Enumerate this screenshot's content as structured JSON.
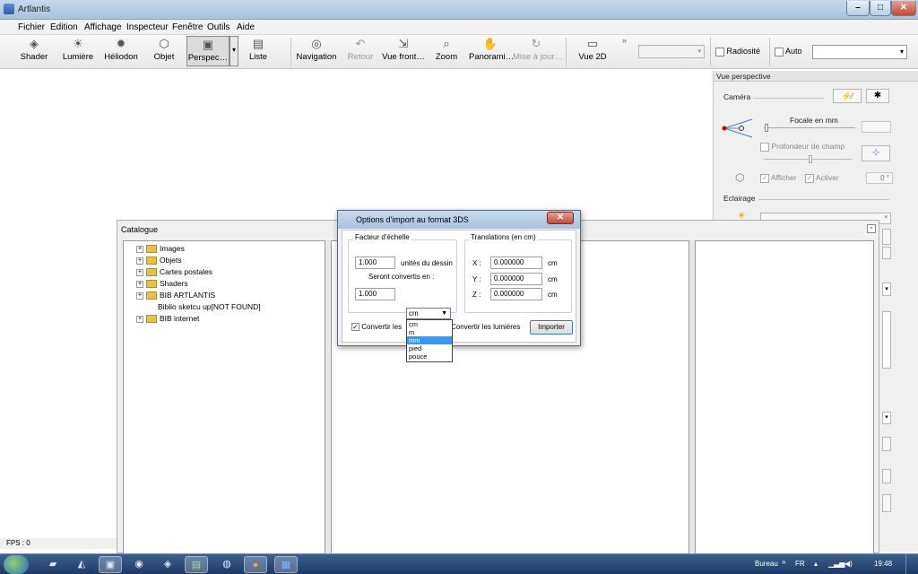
{
  "window": {
    "title": "Artlantis",
    "min": "–",
    "max": "□",
    "close": "✕"
  },
  "menu": [
    "Fichier",
    "Edition",
    "Affichage",
    "Inspecteur",
    "Fenêtre",
    "Outils",
    "Aide"
  ],
  "toolbar": {
    "items": [
      {
        "label": "Shader",
        "icon": "shader-icon",
        "glyph": "◈"
      },
      {
        "label": "Lumière",
        "icon": "light-bulb-icon",
        "glyph": "☀"
      },
      {
        "label": "Héliodon",
        "icon": "sun-icon",
        "glyph": "✹"
      },
      {
        "label": "Objet",
        "icon": "object-cube-icon",
        "glyph": "⬡"
      },
      {
        "label": "Perspec…",
        "icon": "camera-icon",
        "glyph": "▣"
      },
      {
        "label": "Liste",
        "icon": "list-icon",
        "glyph": "▤"
      },
      {
        "label": "Navigation",
        "icon": "navigation-icon",
        "glyph": "◎"
      },
      {
        "label": "Retour",
        "icon": "undo-icon",
        "glyph": "↶"
      },
      {
        "label": "Vue front…",
        "icon": "front-view-icon",
        "glyph": "⇲"
      },
      {
        "label": "Zoom",
        "icon": "zoom-icon",
        "glyph": "⌕"
      },
      {
        "label": "Panorami…",
        "icon": "pan-hand-icon",
        "glyph": "✋"
      },
      {
        "label": "Mise à jour…",
        "icon": "refresh-icon",
        "glyph": "↻"
      },
      {
        "label": "Vue 2D",
        "icon": "view-2d-icon",
        "glyph": "▭"
      }
    ],
    "more": "»",
    "radiosite": "Radiosité",
    "auto": "Auto"
  },
  "status": {
    "fps": "FPS : 0"
  },
  "right_panel": {
    "title": "Vue perspective",
    "camera": "Caméra",
    "focale": "Focale en mm",
    "profondeur": "Profondeur de champ",
    "afficher": "Afficher",
    "activer": "Activer",
    "angle_unit": "0 °",
    "eclairage": "Eclairage"
  },
  "catalog": {
    "title": "Catalogue",
    "tree": [
      "Images",
      "Objets",
      "Cartes postales",
      "Shaders",
      "BIB ARTLANTIS",
      "Biblio sketcu up[NOT FOUND]",
      "BIB internet"
    ]
  },
  "dialog": {
    "title": "Options d'import au format 3DS",
    "close": "✕",
    "scale_legend": "Facteur d'échelle",
    "scale_value": "1.000",
    "scale_unit": "unités du dessin",
    "converted_label": "Seront convertis en :",
    "converted_value": "1.000",
    "unit_selected": "cm",
    "unit_options": [
      "cm",
      "m",
      "mm",
      "pied",
      "pouce"
    ],
    "translations_legend": "Translations (en cm)",
    "x_label": "X :",
    "x_value": "0.000000",
    "y_label": "Y :",
    "y_value": "0.000000",
    "z_label": "Z :",
    "z_value": "0.000000",
    "cm": "cm",
    "convert_les": "Convertir les",
    "convert_lights": "Convertir les lumières",
    "import_button": "Importer"
  },
  "taskbar": {
    "bureau": "Bureau",
    "chev": "»",
    "lang": "FR",
    "time": "19:48"
  }
}
